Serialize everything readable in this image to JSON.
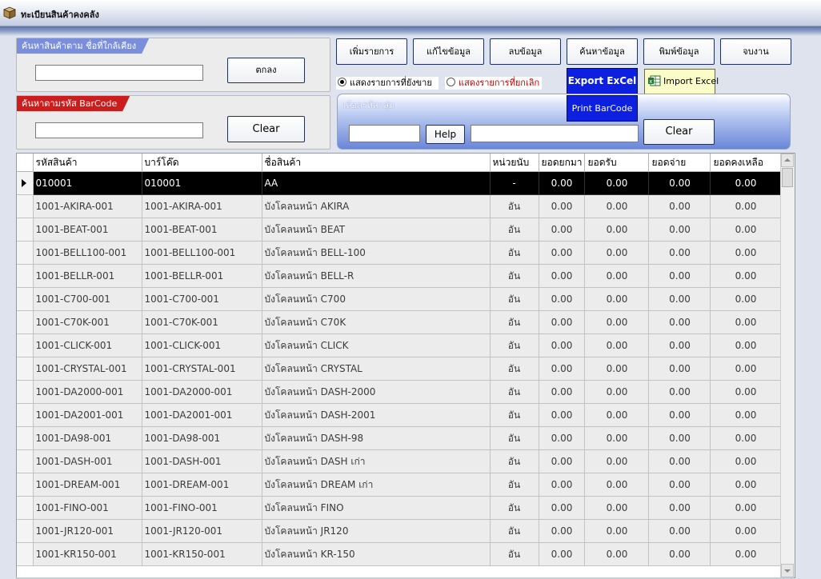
{
  "window": {
    "title": "ทะเบียนสินค้าคงคลัง",
    "icon": "box-icon"
  },
  "search_name": {
    "label": "ค้นหาสินค้าตาม ชื่อที่ใกล้เคียง",
    "value": "",
    "ok_label": "ตกลง"
  },
  "search_barcode": {
    "label": "ค้นหาตามรหัส BarCode",
    "value": "",
    "clear_label": "Clear"
  },
  "toolbar": {
    "add": "เพิ่มรายการ",
    "edit": "แก้ไขข้อมูล",
    "delete": "ลบข้อมูล",
    "find": "ค้นหาข้อมูล",
    "print": "พิมพ์ข้อมูล",
    "close": "จบงาน"
  },
  "filter": {
    "active_label": "แสดงรายการที่ยังขาย",
    "inactive_label": "แสดงรายการที่ยกเลิก",
    "selected": "active"
  },
  "export_excel": "Export ExCel",
  "import_excel": "Import Excel",
  "print_barcode": "Print BarCode",
  "group": {
    "label": "เลือกรหัสกลุ่ม",
    "code_value": "",
    "help_label": "Help",
    "name_value": "",
    "clear_label": "Clear"
  },
  "colors": {
    "accent_blue": "#0d1fe0",
    "tag_red": "#cc1d1d",
    "tag_blue": "#7b8edc",
    "import_yellow": "#fbfdc8"
  },
  "table": {
    "columns": [
      "รหัสสินค้า",
      "บาร์โค๊ด",
      "ชื่อสินค้า",
      "หน่วยนับ",
      "ยอดยกมา",
      "ยอดรับ",
      "ยอดจ่าย",
      "ยอดคงเหลือ"
    ],
    "selected_row": 0,
    "rows": [
      [
        "010001",
        "010001",
        "AA",
        "-",
        "0.00",
        "0.00",
        "0.00",
        "0.00"
      ],
      [
        "1001-AKIRA-001",
        "1001-AKIRA-001",
        "บังโคลนหน้า AKIRA",
        "อัน",
        "0.00",
        "0.00",
        "0.00",
        "0.00"
      ],
      [
        "1001-BEAT-001",
        "1001-BEAT-001",
        "บังโคลนหน้า BEAT",
        "อัน",
        "0.00",
        "0.00",
        "0.00",
        "0.00"
      ],
      [
        "1001-BELL100-001",
        "1001-BELL100-001",
        "บังโคลนหน้า BELL-100",
        "อัน",
        "0.00",
        "0.00",
        "0.00",
        "0.00"
      ],
      [
        "1001-BELLR-001",
        "1001-BELLR-001",
        "บังโคลนหน้า BELL-R",
        "อัน",
        "0.00",
        "0.00",
        "0.00",
        "0.00"
      ],
      [
        "1001-C700-001",
        "1001-C700-001",
        "บังโคลนหน้า C700",
        "อัน",
        "0.00",
        "0.00",
        "0.00",
        "0.00"
      ],
      [
        "1001-C70K-001",
        "1001-C70K-001",
        "บังโคลนหน้า C70K",
        "อัน",
        "0.00",
        "0.00",
        "0.00",
        "0.00"
      ],
      [
        "1001-CLICK-001",
        "1001-CLICK-001",
        "บังโคลนหน้า CLICK",
        "อัน",
        "0.00",
        "0.00",
        "0.00",
        "0.00"
      ],
      [
        "1001-CRYSTAL-001",
        "1001-CRYSTAL-001",
        "บังโคลนหน้า CRYSTAL",
        "อัน",
        "0.00",
        "0.00",
        "0.00",
        "0.00"
      ],
      [
        "1001-DA2000-001",
        "1001-DA2000-001",
        "บังโคลนหน้า DASH-2000",
        "อัน",
        "0.00",
        "0.00",
        "0.00",
        "0.00"
      ],
      [
        "1001-DA2001-001",
        "1001-DA2001-001",
        "บังโคลนหน้า DASH-2001",
        "อัน",
        "0.00",
        "0.00",
        "0.00",
        "0.00"
      ],
      [
        "1001-DA98-001",
        "1001-DA98-001",
        "บังโคลนหน้า DASH-98",
        "อัน",
        "0.00",
        "0.00",
        "0.00",
        "0.00"
      ],
      [
        "1001-DASH-001",
        "1001-DASH-001",
        "บังโคลนหน้า DASH เก่า",
        "อัน",
        "0.00",
        "0.00",
        "0.00",
        "0.00"
      ],
      [
        "1001-DREAM-001",
        "1001-DREAM-001",
        "บังโคลนหน้า DREAM เก่า",
        "อัน",
        "0.00",
        "0.00",
        "0.00",
        "0.00"
      ],
      [
        "1001-FINO-001",
        "1001-FINO-001",
        "บังโคลนหน้า FINO",
        "อัน",
        "0.00",
        "0.00",
        "0.00",
        "0.00"
      ],
      [
        "1001-JR120-001",
        "1001-JR120-001",
        "บังโคลนหน้า JR120",
        "อัน",
        "0.00",
        "0.00",
        "0.00",
        "0.00"
      ],
      [
        "1001-KR150-001",
        "1001-KR150-001",
        "บังโคลนหน้า KR-150",
        "อัน",
        "0.00",
        "0.00",
        "0.00",
        "0.00"
      ]
    ]
  }
}
